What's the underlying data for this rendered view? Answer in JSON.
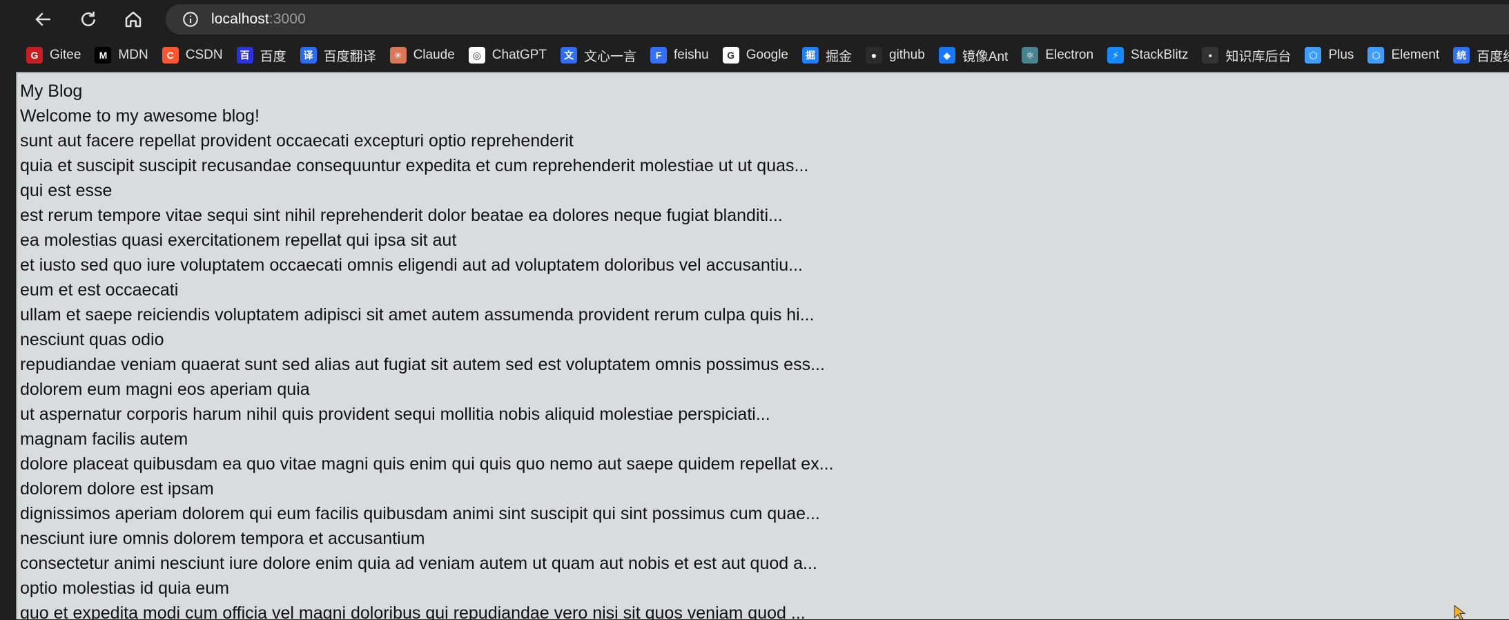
{
  "browser": {
    "url_host": "localhost",
    "url_port": ":3000",
    "icons": [
      "back-arrow-icon",
      "reload-icon",
      "home-icon",
      "info-icon"
    ],
    "bookmarks": [
      {
        "label": "Gitee",
        "icon": "G",
        "color": "#c71d23"
      },
      {
        "label": "MDN",
        "icon": "M",
        "color": "#000000"
      },
      {
        "label": "CSDN",
        "icon": "C",
        "color": "#fc5531"
      },
      {
        "label": "百度",
        "icon": "百",
        "color": "#2932e1"
      },
      {
        "label": "百度翻译",
        "icon": "译",
        "color": "#2a6bf2"
      },
      {
        "label": "Claude",
        "icon": "✳",
        "color": "#d97757"
      },
      {
        "label": "ChatGPT",
        "icon": "◎",
        "color": "#ffffff"
      },
      {
        "label": "文心一言",
        "icon": "文",
        "color": "#2f6ff7"
      },
      {
        "label": "feishu",
        "icon": "F",
        "color": "#3370ff"
      },
      {
        "label": "Google",
        "icon": "G",
        "color": "#ffffff"
      },
      {
        "label": "掘金",
        "icon": "掘",
        "color": "#1e80ff"
      },
      {
        "label": "github",
        "icon": "●",
        "color": "#2b2b2b"
      },
      {
        "label": "镜像Ant",
        "icon": "◆",
        "color": "#1677ff"
      },
      {
        "label": "Electron",
        "icon": "⚛",
        "color": "#47848f"
      },
      {
        "label": "StackBlitz",
        "icon": "⚡",
        "color": "#1389fd"
      },
      {
        "label": "知识库后台",
        "icon": "▪",
        "color": "#333333"
      },
      {
        "label": "Plus",
        "icon": "⬡",
        "color": "#409eff"
      },
      {
        "label": "Element",
        "icon": "⬡",
        "color": "#409eff"
      },
      {
        "label": "百度统",
        "icon": "统",
        "color": "#2f6ff7"
      }
    ]
  },
  "page": {
    "title": "My Blog",
    "subtitle": "Welcome to my awesome blog!",
    "posts": [
      {
        "title": "sunt aut facere repellat provident occaecati excepturi optio reprehenderit",
        "excerpt": "quia et suscipit suscipit recusandae consequuntur expedita et cum reprehenderit molestiae ut ut quas..."
      },
      {
        "title": "qui est esse",
        "excerpt": "est rerum tempore vitae sequi sint nihil reprehenderit dolor beatae ea dolores neque fugiat blanditi..."
      },
      {
        "title": "ea molestias quasi exercitationem repellat qui ipsa sit aut",
        "excerpt": "et iusto sed quo iure voluptatem occaecati omnis eligendi aut ad voluptatem doloribus vel accusantiu..."
      },
      {
        "title": "eum et est occaecati",
        "excerpt": "ullam et saepe reiciendis voluptatem adipisci sit amet autem assumenda provident rerum culpa quis hi..."
      },
      {
        "title": "nesciunt quas odio",
        "excerpt": "repudiandae veniam quaerat sunt sed alias aut fugiat sit autem sed est voluptatem omnis possimus ess..."
      },
      {
        "title": "dolorem eum magni eos aperiam quia",
        "excerpt": "ut aspernatur corporis harum nihil quis provident sequi mollitia nobis aliquid molestiae perspiciati..."
      },
      {
        "title": "magnam facilis autem",
        "excerpt": "dolore placeat quibusdam ea quo vitae magni quis enim qui quis quo nemo aut saepe quidem repellat ex..."
      },
      {
        "title": "dolorem dolore est ipsam",
        "excerpt": "dignissimos aperiam dolorem qui eum facilis quibusdam animi sint suscipit qui sint possimus cum quae..."
      },
      {
        "title": "nesciunt iure omnis dolorem tempora et accusantium",
        "excerpt": "consectetur animi nesciunt iure dolore enim quia ad veniam autem ut quam aut nobis et est aut quod a..."
      },
      {
        "title": "optio molestias id quia eum",
        "excerpt": "quo et expedita modi cum officia vel magni doloribus qui repudiandae vero nisi sit quos veniam quod ..."
      }
    ]
  }
}
